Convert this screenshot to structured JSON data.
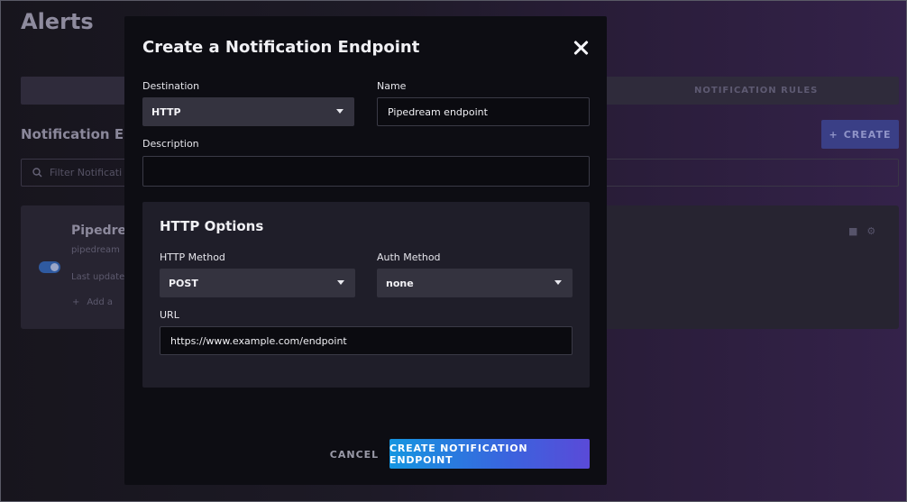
{
  "background": {
    "page_title": "Alerts",
    "tab_rules": "NOTIFICATION RULES",
    "section_title": "Notification En",
    "create_button": "CREATE",
    "filter_placeholder": "Filter Notificati",
    "card": {
      "name": "Pipedre",
      "url": "pipedream",
      "updated": "Last update",
      "add_label": "Add a"
    }
  },
  "modal": {
    "title": "Create a Notification Endpoint",
    "destination": {
      "label": "Destination",
      "value": "HTTP"
    },
    "name": {
      "label": "Name",
      "value": "Pipedream endpoint"
    },
    "description": {
      "label": "Description",
      "value": ""
    },
    "http_options": {
      "title": "HTTP Options",
      "method": {
        "label": "HTTP Method",
        "value": "POST"
      },
      "auth": {
        "label": "Auth Method",
        "value": "none"
      },
      "url": {
        "label": "URL",
        "value": "https://www.example.com/endpoint"
      }
    },
    "cancel_label": "CANCEL",
    "submit_label": "CREATE NOTIFICATION ENDPOINT"
  },
  "colors": {
    "modal_bg": "#0d0d13",
    "panel_bg": "#1f1e29",
    "select_bg": "#34333f",
    "accent_start": "#1596e0",
    "accent_end": "#5a4ad8"
  },
  "icons": [
    "close-icon",
    "caret-down-icon",
    "search-icon",
    "plus-icon",
    "trash-icon",
    "gear-icon"
  ]
}
